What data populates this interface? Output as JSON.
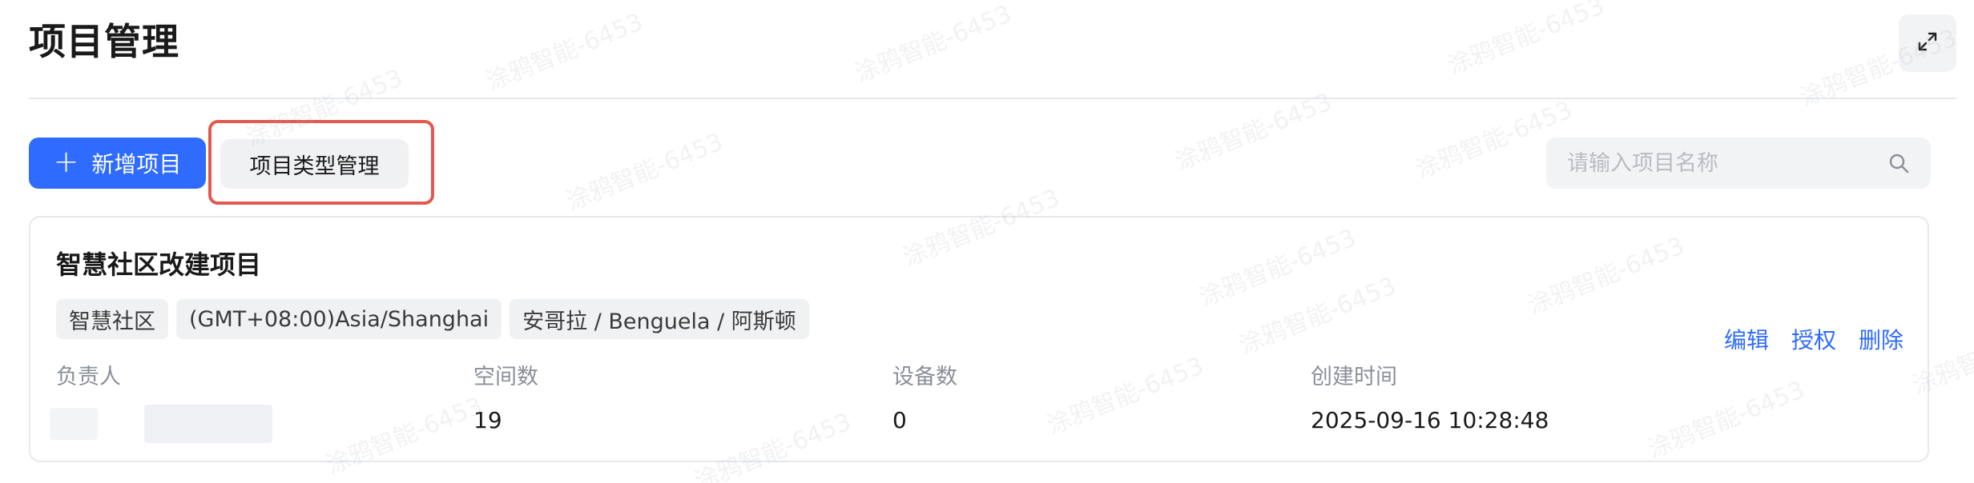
{
  "header": {
    "title": "项目管理",
    "fullscreen_icon": "expand-arrows-icon"
  },
  "toolbar": {
    "add_label": "新增项目",
    "add_icon": "plus-icon",
    "type_manage_label": "项目类型管理"
  },
  "search": {
    "placeholder": "请输入项目名称",
    "value": "",
    "icon": "search-icon"
  },
  "project": {
    "name": "智慧社区改建项目",
    "tags": [
      "智慧社区",
      "(GMT+08:00)Asia/Shanghai",
      "安哥拉 / Benguela / 阿斯顿"
    ],
    "actions": {
      "edit": "编辑",
      "authorize": "授权",
      "delete": "删除"
    },
    "fields": {
      "owner_label": "负责人",
      "space_count_label": "空间数",
      "space_count_value": "19",
      "device_count_label": "设备数",
      "device_count_value": "0",
      "created_label": "创建时间",
      "created_value": "2025-09-16 10:28:48"
    }
  },
  "watermark": "涂鸦智能-6453",
  "colors": {
    "primary": "#2f6bff",
    "highlight": "#e05a4f",
    "tag_bg": "#f0f1f3",
    "divider": "#e6e8eb"
  }
}
